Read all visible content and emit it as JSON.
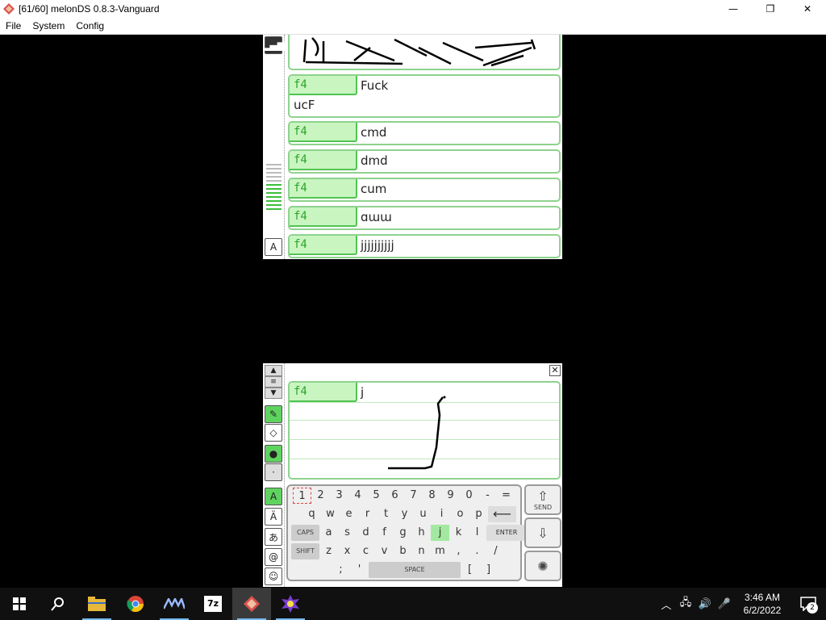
{
  "window": {
    "title": "[61/60] melonDS 0.8.3-Vanguard",
    "minimize_glyph": "—",
    "maximize_glyph": "❐",
    "close_glyph": "✕"
  },
  "menu": {
    "items": [
      "File",
      "System",
      "Config"
    ]
  },
  "top_screen": {
    "messages": [
      {
        "name": "f4",
        "line1": "Fuck",
        "line2": "ucF"
      },
      {
        "name": "f4",
        "line1": "cmd"
      },
      {
        "name": "f4",
        "line1": "dmd"
      },
      {
        "name": "f4",
        "line1": "cum"
      },
      {
        "name": "f4",
        "line1": "ɑɯɯ"
      },
      {
        "name": "f4",
        "line1": "jjjjjjjjjj"
      }
    ]
  },
  "bottom_screen": {
    "draw_name": "f4",
    "draw_text": "j",
    "keyboard": {
      "row1": [
        "1",
        "2",
        "3",
        "4",
        "5",
        "6",
        "7",
        "8",
        "9",
        "0",
        "-",
        "="
      ],
      "row2": [
        "q",
        "w",
        "e",
        "r",
        "t",
        "y",
        "u",
        "i",
        "o",
        "p"
      ],
      "row3": [
        "a",
        "s",
        "d",
        "f",
        "g",
        "h",
        "j",
        "k",
        "l"
      ],
      "row4": [
        "z",
        "x",
        "c",
        "v",
        "b",
        "n",
        "m",
        ",",
        ".",
        "/"
      ],
      "row5": [
        ";",
        "'",
        "[",
        "]"
      ],
      "caps_label": "CAPS",
      "shift_label": "SHIFT",
      "enter_label": "ENTER",
      "space_label": "SPACE",
      "back_glyph": "⟵"
    },
    "send_label": "SEND"
  },
  "taskbar": {
    "apps": [
      "start",
      "search",
      "file-explorer",
      "chrome",
      "app-vlw",
      "7zip",
      "melonds",
      "app-game"
    ],
    "time": "3:46 AM",
    "date": "6/2/2022",
    "notification_count": "2"
  },
  "colors": {
    "accent_green": "#52c452",
    "light_green": "#c8f5c0",
    "highlight_green": "#a3e8a0"
  }
}
